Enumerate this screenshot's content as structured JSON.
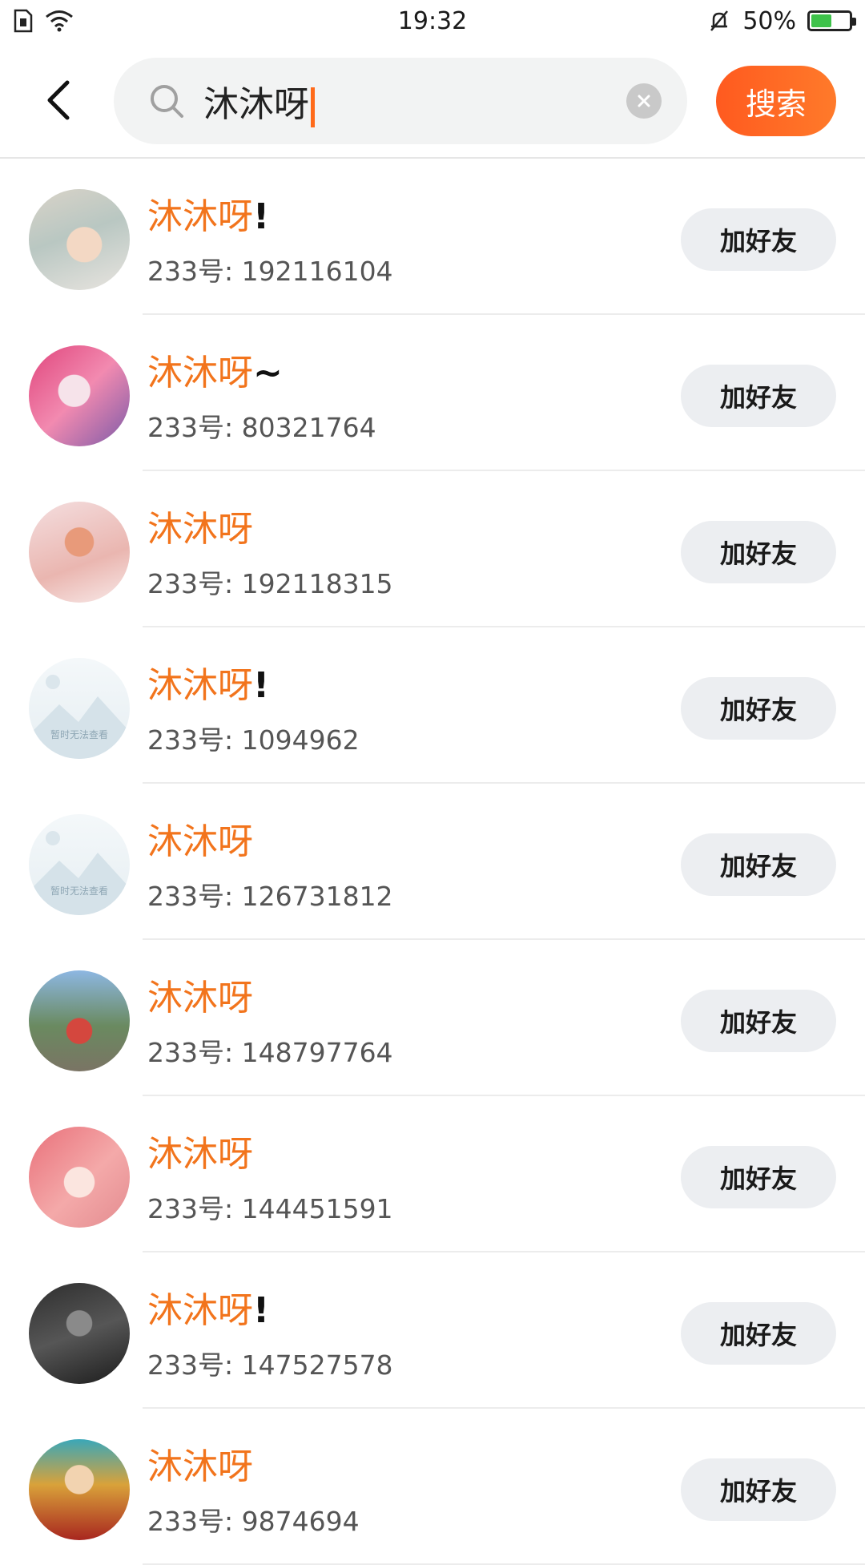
{
  "status_bar": {
    "time": "19:32",
    "battery": "50%"
  },
  "search": {
    "query": "沐沐呀",
    "submit_label": "搜索"
  },
  "results": [
    {
      "name": "沐沐呀",
      "suffix": "!",
      "uid_label": "233号: 192116104",
      "avatar": "anime-girl-room"
    },
    {
      "name": "沐沐呀",
      "suffix": "~",
      "uid_label": "233号: 80321764",
      "avatar": "anime-girl-pink"
    },
    {
      "name": "沐沐呀",
      "suffix": "",
      "uid_label": "233号: 192118315",
      "avatar": "anime-boy"
    },
    {
      "name": "沐沐呀",
      "suffix": "!",
      "uid_label": "233号: 1094962",
      "avatar": "placeholder",
      "placeholder_text": "暂时无法查看"
    },
    {
      "name": "沐沐呀",
      "suffix": "",
      "uid_label": "233号: 126731812",
      "avatar": "placeholder",
      "placeholder_text": "暂时无法查看"
    },
    {
      "name": "沐沐呀",
      "suffix": "",
      "uid_label": "233号: 148797764",
      "avatar": "child-photo"
    },
    {
      "name": "沐沐呀",
      "suffix": "",
      "uid_label": "233号: 144451591",
      "avatar": "anime-girl-red-hair"
    },
    {
      "name": "沐沐呀",
      "suffix": "!",
      "uid_label": "233号: 147527578",
      "avatar": "dark-photo"
    },
    {
      "name": "沐沐呀",
      "suffix": "",
      "uid_label": "233号: 9874694",
      "avatar": "anime-warrior"
    }
  ],
  "add_friend_label": "加好友",
  "colors": {
    "accent": "#ff6a1a",
    "name": "#f2741c",
    "button_bg": "#eceef1"
  }
}
